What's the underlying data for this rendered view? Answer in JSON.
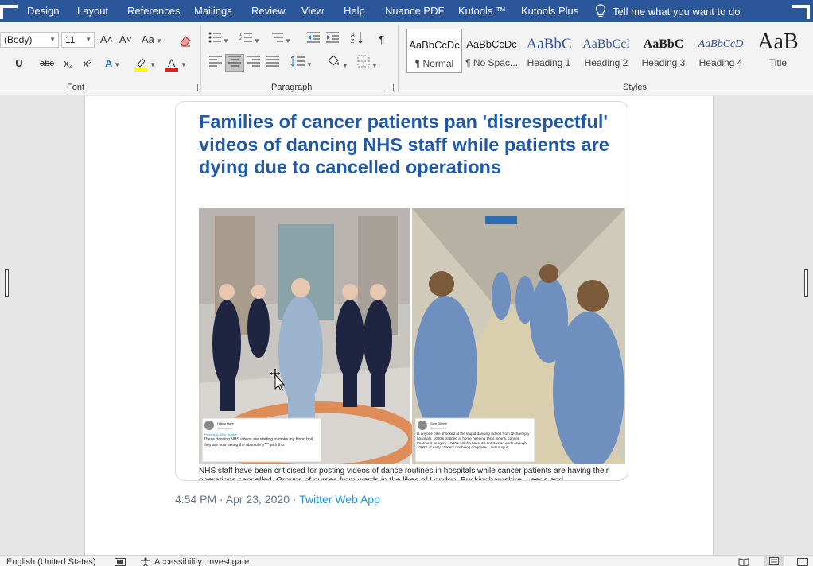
{
  "menubar": {
    "tabs": [
      "Design",
      "Layout",
      "References",
      "Mailings",
      "Review",
      "View",
      "Help",
      "Nuance PDF",
      "Kutools ™",
      "Kutools Plus"
    ],
    "tell_me": "Tell me what you want to do"
  },
  "ribbon": {
    "font": {
      "name": "(Body)",
      "size": "11",
      "group_label": "Font",
      "buttons": {
        "grow": "A˄",
        "shrink": "A˅",
        "case": "Aa",
        "underline": "U",
        "strike": "abc",
        "subscript": "x₂",
        "superscript": "x²"
      },
      "highlight_color": "#ffff00",
      "font_color": "#e02020"
    },
    "paragraph": {
      "group_label": "Paragraph"
    },
    "styles": {
      "group_label": "Styles",
      "items": [
        {
          "sample": "AaBbCcDc",
          "name": "¶ Normal"
        },
        {
          "sample": "AaBbCcDc",
          "name": "¶ No Spac..."
        },
        {
          "sample": "AaBbC",
          "name": "Heading 1"
        },
        {
          "sample": "AaBbCcl",
          "name": "Heading 2"
        },
        {
          "sample": "AaBbC",
          "name": "Heading 3"
        },
        {
          "sample": "AaBbCcD",
          "name": "Heading 4"
        },
        {
          "sample": "AaB",
          "name": "Title"
        }
      ]
    }
  },
  "card": {
    "headline": "Families of cancer patients pan 'disrespectful' videos of dancing NHS staff while patients are dying due to cancelled operations",
    "caption": "NHS staff have been criticised for posting videos of dance routines in hospitals while cancer patients are having their",
    "caption_cut": "operations cancelled. Groups of nurses from wards in the likes of London, Buckinghamshire, Leeds and",
    "tweet_left": {
      "name": "Hilltop Hare",
      "handle": "@hilltophare",
      "reply": "Replying to @the_ladbible",
      "text": "These dancing NHS videos are starting to make my blood boil, they are now taking the absolute p*** with this"
    },
    "tweet_right": {
      "name": "Sam Birkett",
      "handle": "@sambirkett",
      "text": "Is anyone else shocked at the stupid dancing videos from NHS empty hospitals. 1000's trapped at home needing tests, scans, cancer treatment, surgery. 1000's will die because not treated early enough. 1000's of early cancers not being diagnosed. Just stop it!"
    }
  },
  "tweet_meta": {
    "time": "4:54 PM · Apr 23, 2020",
    "sep": " · ",
    "source": "Twitter Web App"
  },
  "statusbar": {
    "language": "English (United States)",
    "accessibility": "Accessibility: Investigate"
  },
  "colors": {
    "title_bar": "#2b579a",
    "headline": "#1e5aa8",
    "link": "#1b95e0"
  }
}
